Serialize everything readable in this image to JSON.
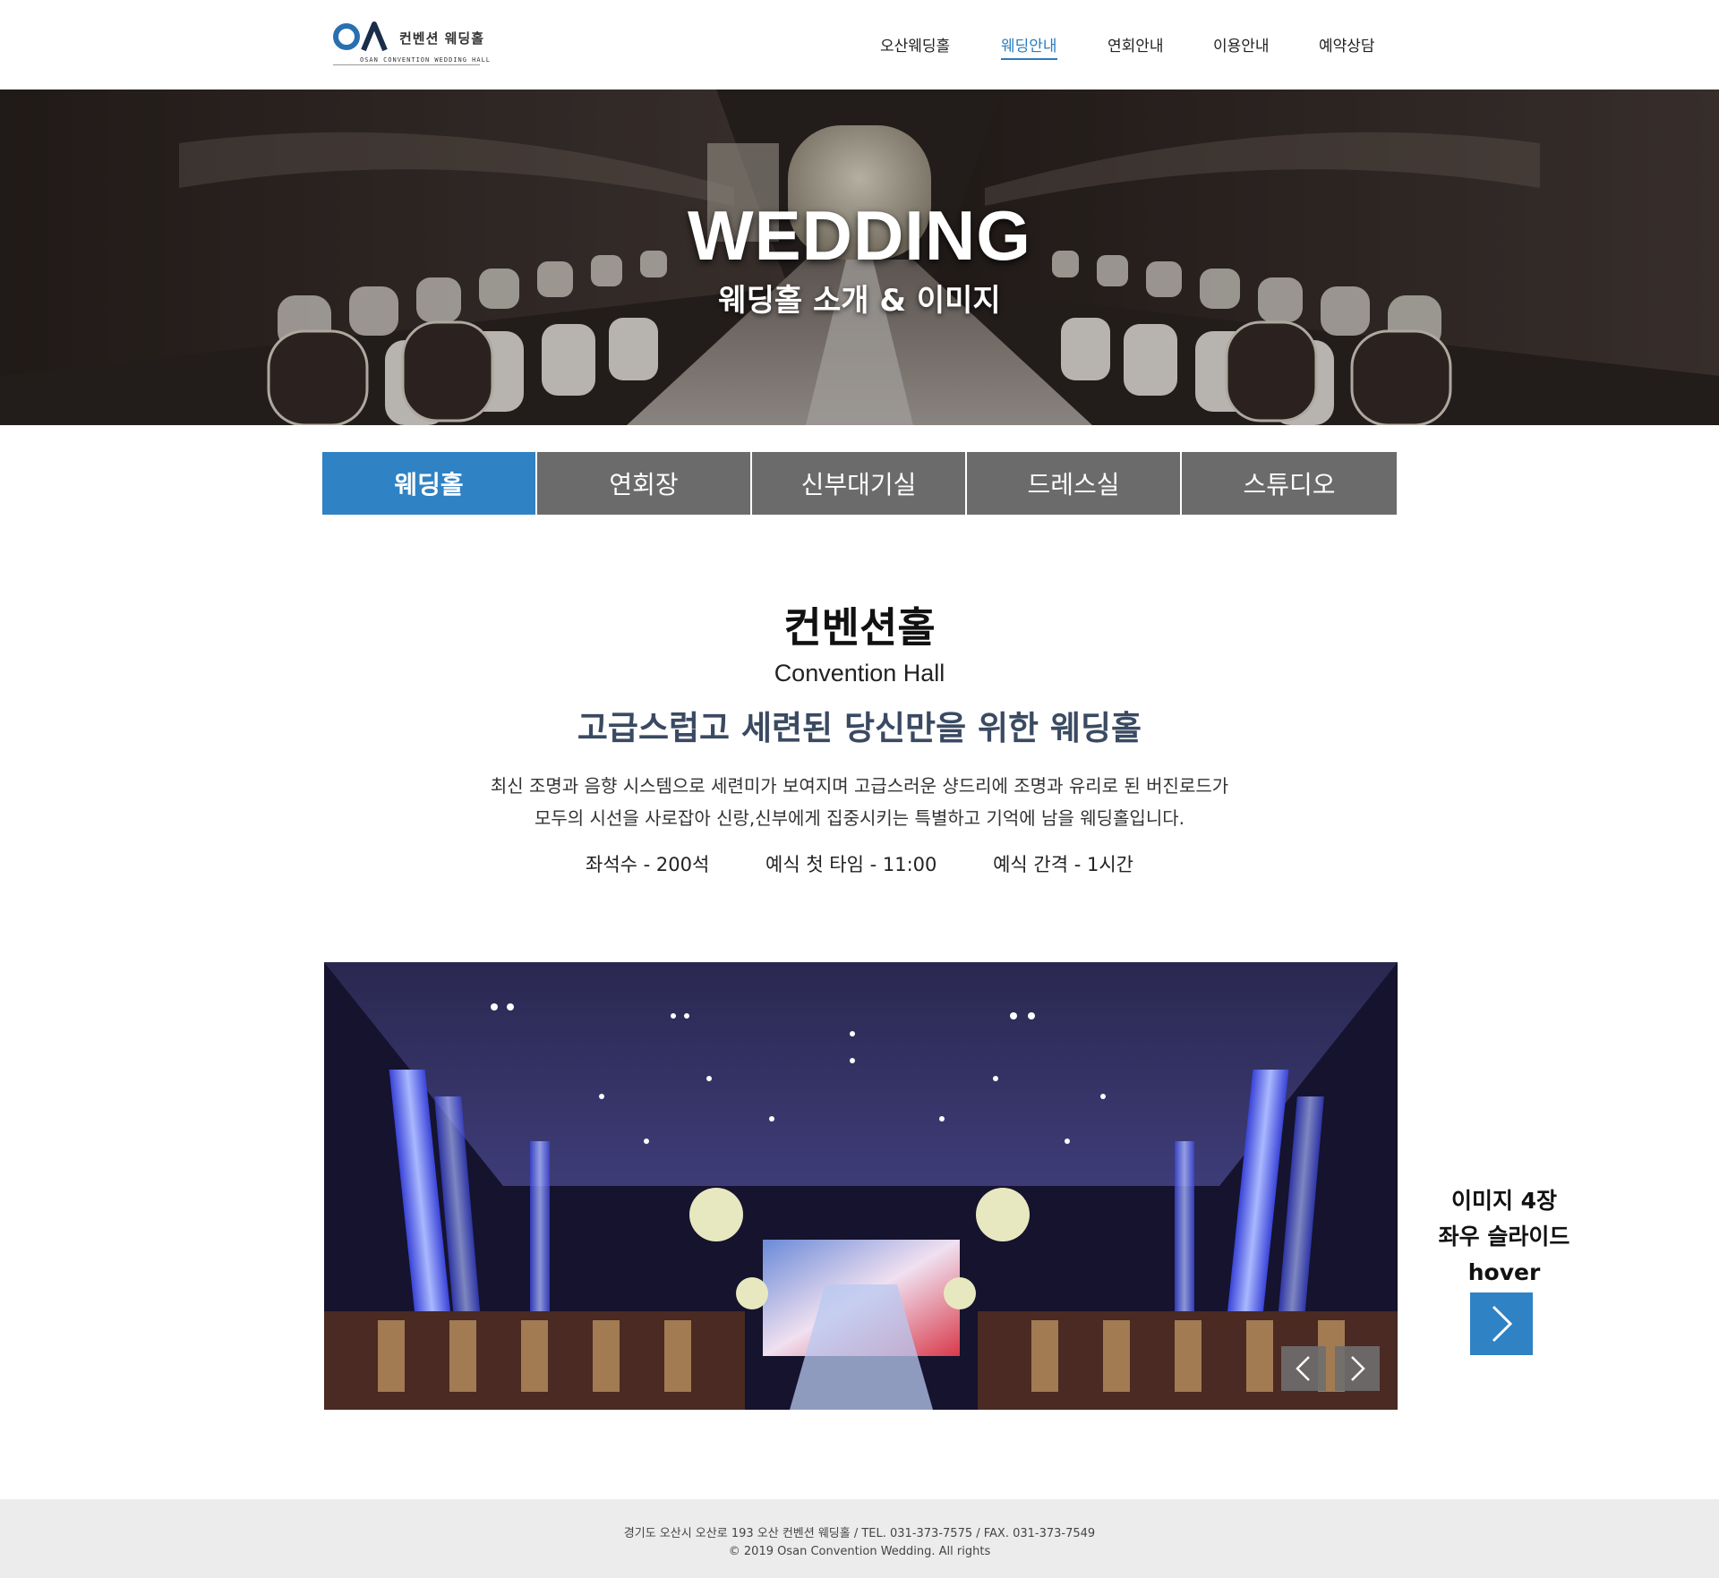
{
  "header": {
    "logo_mark": "OA",
    "logo_ko": "컨벤션 웨딩홀",
    "logo_en": "OSAN CONVENTION WEDDING HALL",
    "nav": [
      {
        "label": "오산웨딩홀"
      },
      {
        "label": "웨딩안내"
      },
      {
        "label": "연회안내"
      },
      {
        "label": "이용안내"
      },
      {
        "label": "예약상담"
      }
    ],
    "active_nav": "웨딩안내",
    "accent_color": "#2a7bc0"
  },
  "hero": {
    "title": "WEDDING",
    "subtitle": "웨딩홀 소개 & 이미지"
  },
  "tabs": [
    {
      "label": "웨딩홀"
    },
    {
      "label": "연회장"
    },
    {
      "label": "신부대기실"
    },
    {
      "label": "드레스실"
    },
    {
      "label": "스튜디오"
    }
  ],
  "active_tab": "웨딩홀",
  "intro": {
    "title": "컨벤션홀",
    "title_en": "Convention Hall",
    "tagline": "고급스럽고 세련된 당신만을 위한 웨딩홀",
    "desc_line1": "최신 조명과 음향 시스템으로 세련미가 보여지며 고급스러운 샹드리에 조명과 유리로 된 버진로드가",
    "desc_line2": "모두의 시선을 사로잡아 신랑,신부에게 집중시키는 특별하고 기억에 남을 웨딩홀입니다.",
    "facts": [
      {
        "label": "좌석수 - 200석"
      },
      {
        "label": "예식 첫 타임 - 11:00"
      },
      {
        "label": "예식 간격 - 1시간"
      }
    ]
  },
  "slider": {
    "prev_icon": "chevron-left-icon",
    "next_icon": "chevron-right-icon"
  },
  "note": {
    "line1": "이미지 4장",
    "line2": "좌우 슬라이드",
    "line3": "hover",
    "button_icon": "chevron-right-icon",
    "button_color": "#2f82c4"
  },
  "footer": {
    "line1": "경기도 오산시 오산로 193 오산 컨벤션 웨딩홀 / TEL. 031-373-7575 / FAX. 031-373-7549",
    "line2": "© 2019 Osan Convention Wedding. All rights"
  }
}
